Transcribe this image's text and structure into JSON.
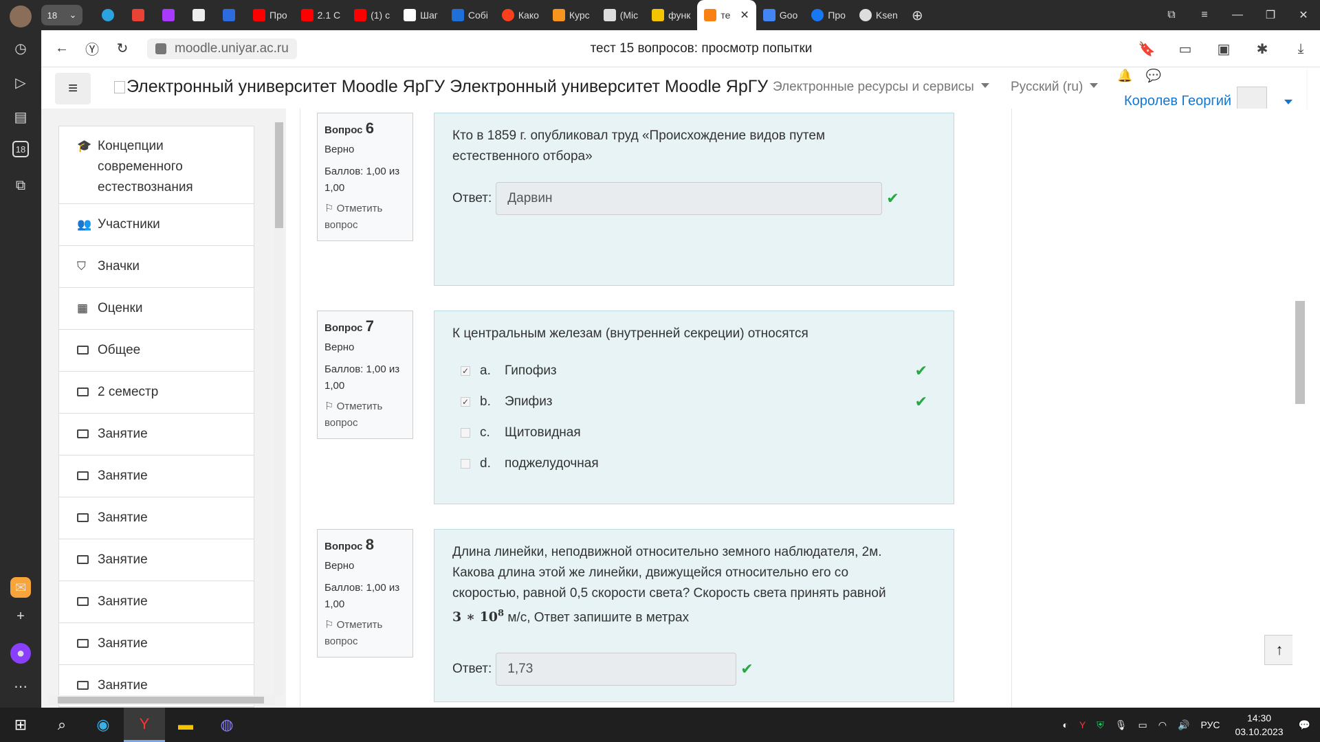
{
  "browser": {
    "tab_group_count": "18",
    "tabs": [
      {
        "label": "Про",
        "color": "#ff0000"
      },
      {
        "label": "2.1 С",
        "color": "#ff0000"
      },
      {
        "label": "(1) с",
        "color": "#ff0000"
      },
      {
        "label": "Шаг",
        "color": "#ffffff"
      },
      {
        "label": "Собі",
        "color": "#1e6fd9"
      },
      {
        "label": "Како",
        "color": "#fc3f1d"
      },
      {
        "label": "Курс",
        "color": "#f7941d"
      },
      {
        "label": "(Mic",
        "color": "#dddddd"
      },
      {
        "label": "функ",
        "color": "#f5c400"
      }
    ],
    "active_tab": {
      "label": "те",
      "color": "#f98012"
    },
    "tabs_after": [
      {
        "label": "Goo",
        "color": "#4285f4"
      },
      {
        "label": "Про",
        "color": "#1877f2"
      },
      {
        "label": "Ksen",
        "color": "#dddddd"
      }
    ],
    "url": "moodle.uniyar.ac.ru",
    "page_title": "тест 15 вопросов: просмотр попытки"
  },
  "navbar": {
    "brand_alt": "Электронный университет Moodle ЯрГУ",
    "brand_text": "Электронный университет Moodle ЯрГУ",
    "menu_resources": "Электронные ресурсы и сервисы",
    "menu_language": "Русский (ru)",
    "user_name": "Королев Георгий"
  },
  "drawer": {
    "items": [
      {
        "icon": "graduation-cap-icon",
        "label": "Концепции современного естествознания"
      },
      {
        "icon": "users-icon",
        "label": "Участники"
      },
      {
        "icon": "shield-icon",
        "label": "Значки"
      },
      {
        "icon": "table-icon",
        "label": "Оценки"
      },
      {
        "icon": "folder-icon",
        "label": "Общее"
      },
      {
        "icon": "folder-icon",
        "label": "2 семестр"
      },
      {
        "icon": "folder-icon",
        "label": "Занятие"
      },
      {
        "icon": "folder-icon",
        "label": "Занятие"
      },
      {
        "icon": "folder-icon",
        "label": "Занятие"
      },
      {
        "icon": "folder-icon",
        "label": "Занятие"
      },
      {
        "icon": "folder-icon",
        "label": "Занятие"
      },
      {
        "icon": "folder-icon",
        "label": "Занятие"
      },
      {
        "icon": "folder-icon",
        "label": "Занятие"
      }
    ]
  },
  "questions": [
    {
      "label": "Вопрос",
      "number": "6",
      "status": "Верно",
      "score_line1": "Баллов: 1,00 из",
      "score_line2": "1,00",
      "flag_line1": "Отметить",
      "flag_line2": "вопрос",
      "text": "Кто в 1859 г. опубликовал труд «Происхождение видов путем естественного отбора»",
      "answer_label": "Ответ:",
      "answer_value": "Дарвин"
    },
    {
      "label": "Вопрос",
      "number": "7",
      "status": "Верно",
      "score_line1": "Баллов: 1,00 из",
      "score_line2": "1,00",
      "flag_line1": "Отметить",
      "flag_line2": "вопрос",
      "text": "К центральным железам (внутренней секреции) относятся",
      "options": [
        {
          "letter": "a.",
          "text": "Гипофиз",
          "checked": true,
          "correct": true
        },
        {
          "letter": "b.",
          "text": "Эпифиз",
          "checked": true,
          "correct": true
        },
        {
          "letter": "c.",
          "text": "Щитовидная",
          "checked": false,
          "correct": false
        },
        {
          "letter": "d.",
          "text": "поджелудочная",
          "checked": false,
          "correct": false
        }
      ]
    },
    {
      "label": "Вопрос",
      "number": "8",
      "status": "Верно",
      "score_line1": "Баллов: 1,00 из",
      "score_line2": "1,00",
      "flag_line1": "Отметить",
      "flag_line2": "вопрос",
      "text_line1": "Длина линейки, неподвижной относительно земного наблюдателя, 2м.",
      "text_line2": "Какова длина этой же линейки, движущейся относительно его со",
      "text_line3": "скоростью, равной 0,5 скорости света? Скорость света принять равной",
      "formula_base": "3 ∗ 10",
      "formula_exp": "8",
      "text_line4": "м/с, Ответ запишите в метрах",
      "answer_label": "Ответ:",
      "answer_value": "1,73"
    }
  ],
  "taskbar": {
    "language": "РУС",
    "time": "14:30",
    "date": "03.10.2023"
  },
  "colors": {
    "correct": "#28a745",
    "link": "#1177d1",
    "question_bg": "#e7f3f5"
  }
}
